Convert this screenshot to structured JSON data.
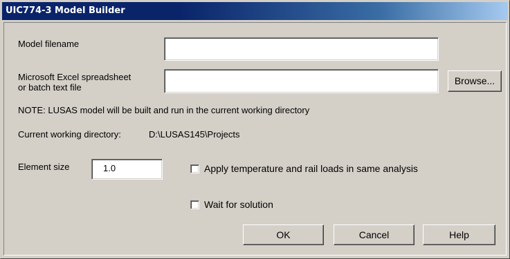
{
  "window": {
    "title": "UIC774-3 Model Builder"
  },
  "fields": {
    "model_filename_label": "Model filename",
    "model_filename_value": "",
    "excel_label_line1": "Microsoft Excel spreadsheet",
    "excel_label_line2": "or batch text file",
    "excel_value": "",
    "browse_label": "Browse...",
    "element_size_label": "Element size",
    "element_size_value": "1.0"
  },
  "info": {
    "note": "NOTE: LUSAS model will be built and run in the current working directory",
    "cwd_label": "Current working directory:",
    "cwd_value": "D:\\LUSAS145\\Projects"
  },
  "options": {
    "apply_temp_label": "Apply temperature and rail loads in same analysis",
    "apply_temp_checked": false,
    "wait_label": "Wait for solution",
    "wait_checked": false
  },
  "buttons": {
    "ok": "OK",
    "cancel": "Cancel",
    "help": "Help"
  }
}
